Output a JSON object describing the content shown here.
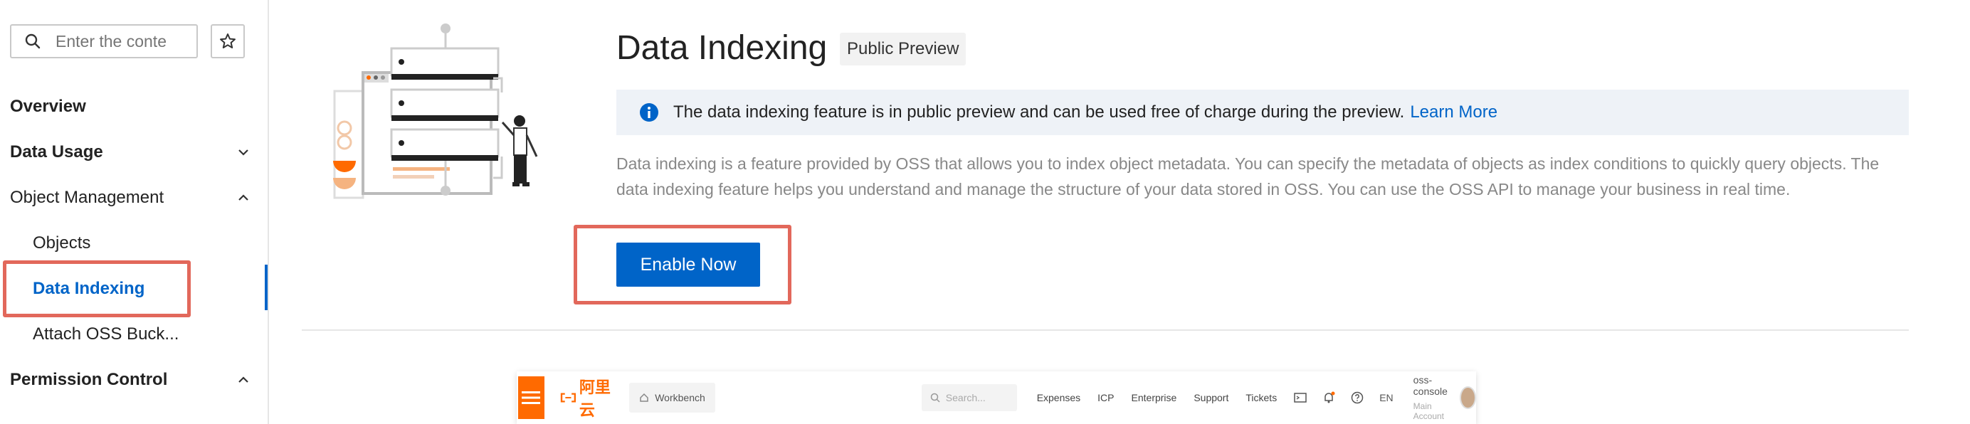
{
  "sidebar": {
    "search_placeholder": "Enter the conte",
    "items": [
      {
        "label": "Overview"
      },
      {
        "label": "Data Usage"
      },
      {
        "label": "Object Management"
      },
      {
        "label": "Objects"
      },
      {
        "label": "Data Indexing"
      },
      {
        "label": "Attach OSS Buck..."
      },
      {
        "label": "Permission Control"
      }
    ]
  },
  "main": {
    "title": "Data Indexing",
    "badge": "Public Preview",
    "info_text": "The data indexing feature is in public preview and can be used free of charge during the preview.",
    "learn_more": "Learn More",
    "description": "Data indexing is a feature provided by OSS that allows you to index object metadata. You can specify the metadata of objects as index conditions to quickly query objects. The data indexing feature helps you understand and manage the structure of your data stored in OSS. You can use the OSS API to manage your business in real time.",
    "enable_button": "Enable Now"
  },
  "console": {
    "logo": "阿里云",
    "workbench": "Workbench",
    "search_placeholder": "Search...",
    "links": [
      "Expenses",
      "ICP",
      "Enterprise",
      "Support",
      "Tickets"
    ],
    "lang": "EN",
    "account_name": "oss-console",
    "account_type": "Main Account"
  },
  "colors": {
    "accent": "#0064c8",
    "highlight": "#e2685b",
    "brand_orange": "#ff6a00",
    "info_bg": "#eef2f7"
  }
}
